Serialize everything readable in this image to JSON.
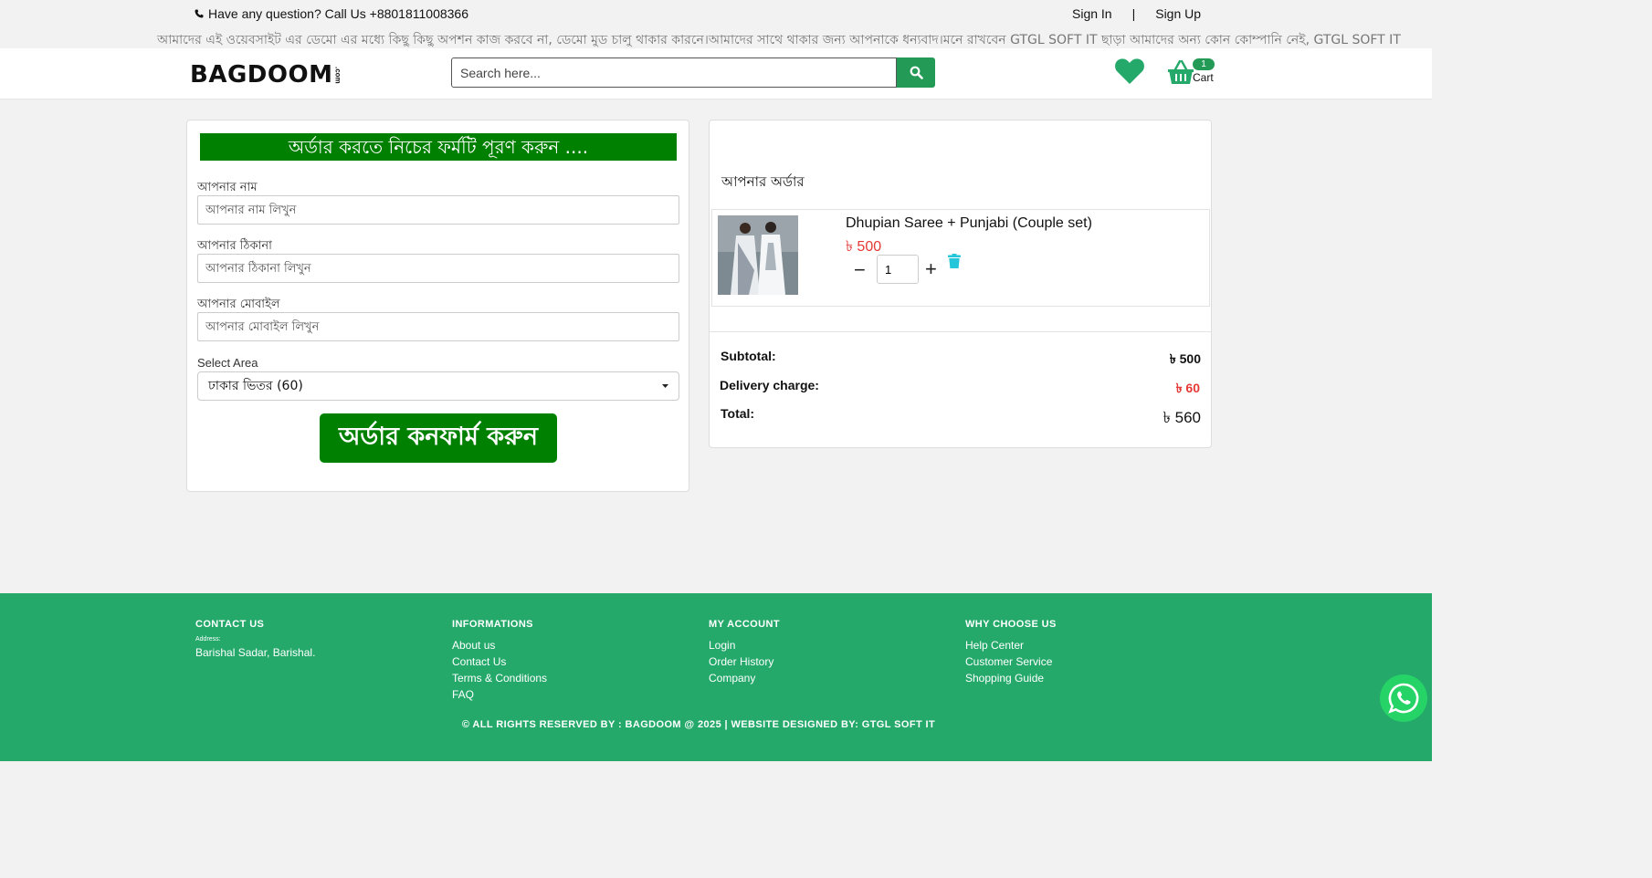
{
  "topbar": {
    "phone_text": "Have any question? Call Us +8801811008366",
    "sign_in": "Sign In",
    "separator": "|",
    "sign_up": "Sign Up",
    "marquee": "আমাদের এই ওয়েবসাইট এর ডেমো এর মধ্যে কিছু কিছু অপশন কাজ করবে না, ডেমো মুড চালু থাকার কারনে।আমাদের সাথে থাকার জন্য আপনাকে ধন্যবাদ।মনে রাখবেন GTGL SOFT IT ছাড়া আমাদের অন্য কোন কোম্পানি নেই, GTGL SOFT IT"
  },
  "header": {
    "logo_text": "BAGDOOM",
    "logo_suffix": ".com",
    "search_placeholder": "Search here...",
    "cart_count": "1",
    "cart_label": "Cart"
  },
  "form": {
    "title": "অর্ডার করতে নিচের ফর্মটি পূরণ করুন ....",
    "name_label": "আপনার নাম",
    "name_placeholder": "আপনার নাম লিখুন",
    "address_label": "আপনার ঠিকানা",
    "address_placeholder": "আপনার ঠিকানা লিখুন",
    "mobile_label": "আপনার মোবাইল",
    "mobile_placeholder": "আপনার মোবাইল লিখুন",
    "area_label": "Select Area",
    "area_selected": "ঢাকার ভিতর (60)",
    "confirm_button": "অর্ডার কনফার্ম করুন"
  },
  "order": {
    "heading": "আপনার অর্ডার",
    "item": {
      "name": "Dhupian Saree + Punjabi (Couple set)",
      "price": "৳ 500",
      "quantity": "1"
    },
    "summary": {
      "subtotal_label": "Subtotal:",
      "subtotal_value": "৳ 500",
      "delivery_label": "Delivery charge:",
      "delivery_value": "৳ 60",
      "total_label": "Total:",
      "total_value": "৳ 560"
    }
  },
  "footer": {
    "contact": {
      "title": "CONTACT US",
      "address_label": "Address:",
      "address": "Barishal Sadar, Barishal."
    },
    "informations": {
      "title": "INFORMATIONS",
      "links": [
        "About us",
        "Contact Us",
        "Terms & Conditions",
        "FAQ"
      ]
    },
    "account": {
      "title": "MY ACCOUNT",
      "links": [
        "Login",
        "Order History",
        "Company"
      ]
    },
    "why": {
      "title": "WHY CHOOSE US",
      "links": [
        "Help Center",
        "Customer Service",
        "Shopping Guide"
      ]
    },
    "copyright": "© ALL RIGHTS RESERVED BY : BAGDOOM @ 2025 | WEBSITE DESIGNED BY: GTGL SOFT IT"
  },
  "colors": {
    "brand_green": "#239b56",
    "form_green": "#008000",
    "footer_green": "#24a96b",
    "price_red": "#e53935"
  }
}
